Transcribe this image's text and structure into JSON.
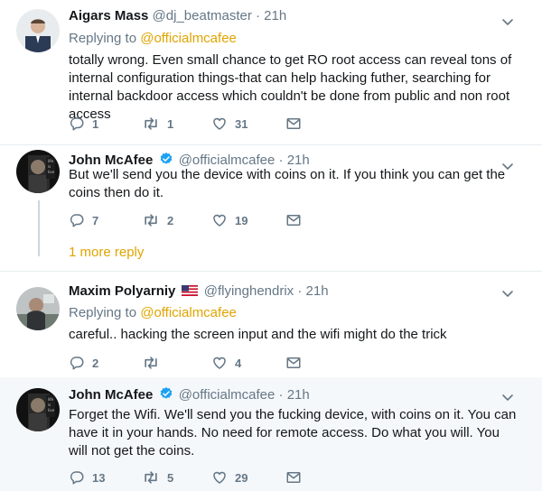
{
  "tweets": [
    {
      "name": "Aigars Mass",
      "handle": "@dj_beatmaster",
      "time": "21h",
      "replying_prefix": "Replying to",
      "replying_mention": "@officialmcafee",
      "text": "totally wrong. Even small chance to get RO root access can reveal tons of internal configuration things-that can help hacking futher, searching for internal backdoor access which couldn't be done from public and non root access",
      "replies": "1",
      "retweets": "1",
      "likes": "31"
    },
    {
      "name": "John McAfee",
      "handle": "@officialmcafee",
      "time": "21h",
      "text": "But we'll send you the device with coins on it. If you think you can get the coins then do it.",
      "replies": "7",
      "retweets": "2",
      "likes": "19",
      "more_replies": "1 more reply"
    },
    {
      "name": "Maxim Polyarniy",
      "handle": "@flyinghendrix",
      "time": "21h",
      "replying_prefix": "Replying to",
      "replying_mention": "@officialmcafee",
      "text": "careful.. hacking the screen input and the wifi might do the trick",
      "replies": "2",
      "retweets": "",
      "likes": "4"
    },
    {
      "name": "John McAfee",
      "handle": "@officialmcafee",
      "time": "21h",
      "text": "Forget the Wifi. We'll send you the fucking device, with coins on it. You can have it in your hands. No need for remote access. Do what you will. You will not get the coins.",
      "replies": "13",
      "retweets": "5",
      "likes": "29"
    }
  ],
  "separator": "·",
  "icons": {
    "reply": "reply-icon",
    "retweet": "retweet-icon",
    "like": "heart-icon",
    "dm": "envelope-icon",
    "chevron": "chevron-down-icon",
    "verified": "verified-badge-icon",
    "flag": "us-flag-icon"
  },
  "colors": {
    "mention": "#e0a400",
    "muted": "#657786",
    "verified": "#1da1f2",
    "highlight": "#f5f8fa"
  }
}
